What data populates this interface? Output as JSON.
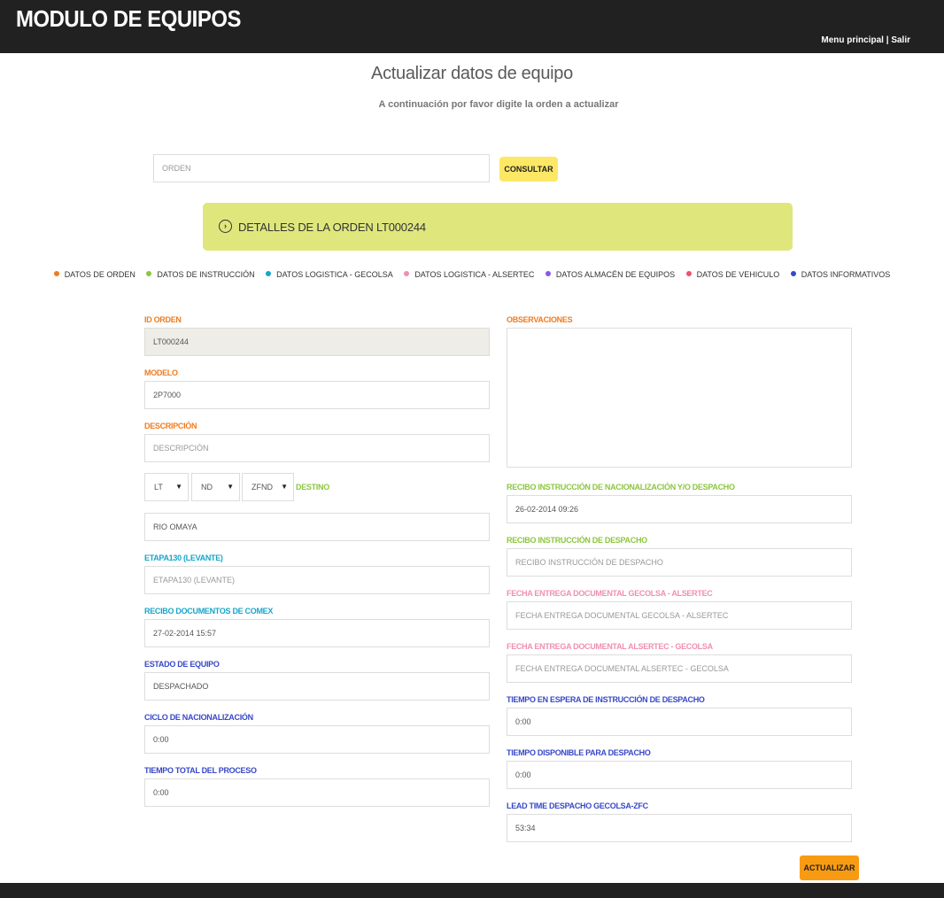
{
  "header": {
    "app_title": "MODULO DE EQUIPOS",
    "nav_menu": "Menu principal",
    "nav_separator": " | ",
    "nav_exit": "Salir"
  },
  "page": {
    "title": "Actualizar datos de equipo",
    "subtitle": "A continuación por favor digite la orden a actualizar"
  },
  "search": {
    "placeholder": "ORDEN",
    "button": "CONSULTAR"
  },
  "details": {
    "icon": "chevron-right-circle-icon",
    "title": "DETALLES DE LA ORDEN LT000244"
  },
  "legend": [
    {
      "label": "DATOS DE ORDEN",
      "color": "#f07b1d"
    },
    {
      "label": "DATOS DE INSTRUCCIÓN",
      "color": "#8cc63f"
    },
    {
      "label": "DATOS LOGISTICA - GECOLSA",
      "color": "#17a6c9"
    },
    {
      "label": "DATOS LOGISTICA - ALSERTEC",
      "color": "#f08fb0"
    },
    {
      "label": "DATOS ALMACÉN DE EQUIPOS",
      "color": "#8a5ae0"
    },
    {
      "label": "DATOS DE VEHICULO",
      "color": "#f0506e"
    },
    {
      "label": "DATOS INFORMATIVOS",
      "color": "#3848c8"
    }
  ],
  "form": {
    "id_orden": {
      "label": "ID ORDEN",
      "value": "LT000244"
    },
    "modelo": {
      "label": "MODELO",
      "value": "2P7000"
    },
    "descripcion": {
      "label": "DESCRIPCIÓN",
      "placeholder": "DESCRIPCIÓN"
    },
    "selects": {
      "s1": "LT",
      "s2": "ND",
      "s3": "ZFND"
    },
    "destino": {
      "label": "DESTINO",
      "value": "RIO OMAYA"
    },
    "etapa130": {
      "label": "ETAPA130 (LEVANTE)",
      "placeholder": "ETAPA130 (LEVANTE)"
    },
    "recibo_comex": {
      "label": "RECIBO DOCUMENTOS DE COMEX",
      "value": "27-02-2014 15:57"
    },
    "estado_equipo": {
      "label": "ESTADO DE EQUIPO",
      "value": "DESPACHADO"
    },
    "ciclo_nac": {
      "label": "CICLO DE NACIONALIZACIÓN",
      "value": "0:00"
    },
    "tiempo_total": {
      "label": "TIEMPO TOTAL DEL PROCESO",
      "value": "0:00"
    },
    "observaciones": {
      "label": "OBSERVACIONES"
    },
    "recibo_inst_nac": {
      "label": "RECIBO INSTRUCCIÓN DE NACIONALIZACIÓN Y/O DESPACHO",
      "value": "26-02-2014 09:26"
    },
    "recibo_inst_desp": {
      "label": "RECIBO INSTRUCCIÓN DE DESPACHO",
      "placeholder": "RECIBO INSTRUCCIÓN DE DESPACHO"
    },
    "fecha_gec_als": {
      "label": "FECHA ENTREGA DOCUMENTAL GECOLSA - ALSERTEC",
      "placeholder": "FECHA ENTREGA DOCUMENTAL GECOLSA - ALSERTEC"
    },
    "fecha_als_gec": {
      "label": "FECHA ENTREGA DOCUMENTAL ALSERTEC - GECOLSA",
      "placeholder": "FECHA ENTREGA DOCUMENTAL ALSERTEC - GECOLSA"
    },
    "tiempo_espera": {
      "label": "TIEMPO EN ESPERA DE INSTRUCCIÓN DE DESPACHO",
      "value": "0:00"
    },
    "tiempo_disp": {
      "label": "TIEMPO DISPONIBLE PARA DESPACHO",
      "value": "0:00"
    },
    "lead_time": {
      "label": "LEAD TIME DESPACHO GECOLSA-ZFC",
      "value": "53:34"
    }
  },
  "actions": {
    "update_button": "ACTUALIZAR"
  }
}
